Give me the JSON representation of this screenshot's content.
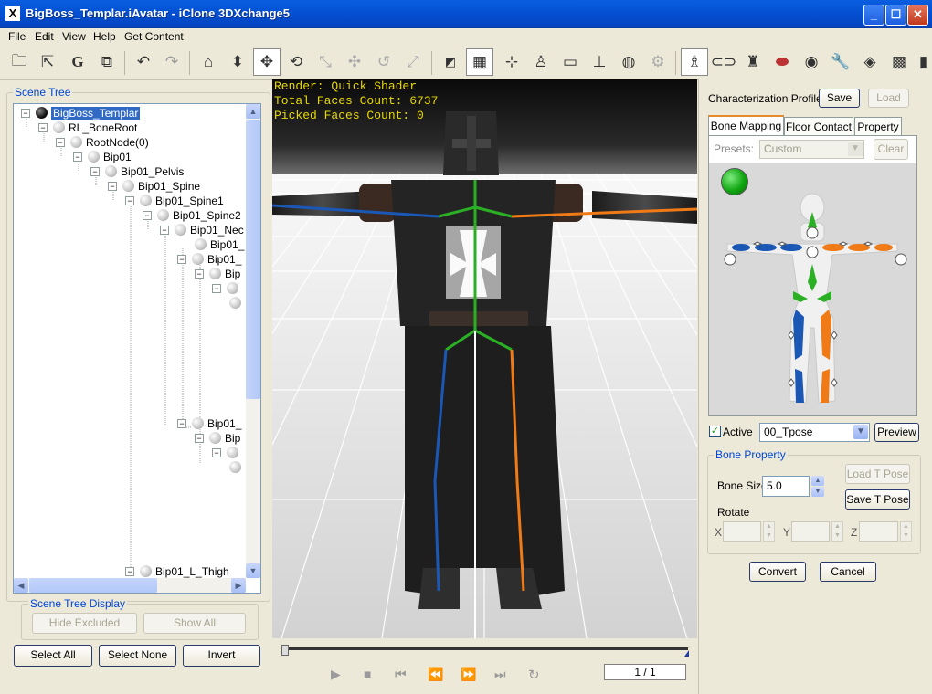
{
  "window": {
    "title": "BigBoss_Templar.iAvatar - iClone 3DXchange5",
    "app_icon": "X"
  },
  "menu": [
    "File",
    "Edit",
    "View",
    "Help",
    "Get Content"
  ],
  "toolbar_icons": [
    "open-folder-icon",
    "export-icon",
    "g-icon",
    "convert-icon",
    "undo-icon",
    "redo-icon",
    "home-icon",
    "down-arrow-icon",
    "move-icon",
    "rotate-icon",
    "scale-icon",
    "pan-icon",
    "reset-icon",
    "fit-icon",
    "wireframe-icon",
    "grid-icon",
    "axis-icon",
    "light-icon",
    "box-icon",
    "ground-icon",
    "globe-icon",
    "settings-icon",
    "character-icon",
    "pill-icon",
    "bones-icon",
    "morph-icon",
    "sphere-icon",
    "wrench-icon",
    "tag-icon",
    "paint-icon"
  ],
  "scene_tree": {
    "label": "Scene Tree",
    "nodes": [
      {
        "label": "BigBoss_Templar",
        "selected": true
      },
      {
        "label": "RL_BoneRoot"
      },
      {
        "label": "RootNode(0)"
      },
      {
        "label": "Bip01"
      },
      {
        "label": "Bip01_Pelvis"
      },
      {
        "label": "Bip01_Spine"
      },
      {
        "label": "Bip01_Spine1"
      },
      {
        "label": "Bip01_Spine2"
      },
      {
        "label": "Bip01_Nec"
      },
      {
        "label": "Bip01_"
      },
      {
        "label": "Bip01_"
      },
      {
        "label": "Bip"
      },
      {
        "label": ""
      },
      {
        "label": ""
      },
      {
        "label": "Bip01_"
      },
      {
        "label": "Bip"
      },
      {
        "label": ""
      },
      {
        "label": ""
      },
      {
        "label": "Bip01_L_Thigh"
      }
    ]
  },
  "scene_tree_display": {
    "label": "Scene Tree Display",
    "hide_excluded": "Hide Excluded",
    "show_all": "Show All"
  },
  "tree_buttons": {
    "select_all": "Select All",
    "select_none": "Select None",
    "invert": "Invert"
  },
  "viewport": {
    "render": "Render: Quick Shader",
    "total_faces": "Total Faces Count: 6737",
    "picked_faces": "Picked Faces Count: 0"
  },
  "timeline": {
    "frame": "1 / 1",
    "progress": 0.0
  },
  "right": {
    "profile_label": "Characterization Profile",
    "save": "Save",
    "load": "Load",
    "tabs": [
      "Bone Mapping",
      "Floor Contact",
      "Property"
    ],
    "presets_label": "Presets:",
    "preset_value": "Custom",
    "clear": "Clear",
    "active_label": "Active",
    "pose_value": "00_Tpose",
    "preview": "Preview",
    "bone_property_label": "Bone Property",
    "bone_size_label": "Bone Size",
    "bone_size_value": "5.0",
    "load_t_pose": "Load T Pose",
    "save_t_pose": "Save T Pose",
    "rotate_label": "Rotate",
    "x": "X",
    "y": "Y",
    "z": "Z",
    "convert": "Convert",
    "cancel": "Cancel"
  },
  "colors": {
    "left_limb": "#1b57b5",
    "right_limb": "#f07a16",
    "spine": "#2bb025",
    "status_dot": "#11a611"
  }
}
